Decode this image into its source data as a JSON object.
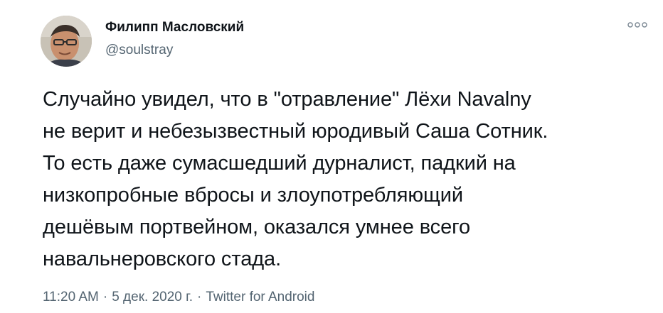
{
  "author": {
    "display_name": "Филипп Масловский",
    "handle": "@soulstray"
  },
  "icons": {
    "more": "more-options-icon",
    "avatar": "user-avatar"
  },
  "tweet": {
    "text": "Случайно увидел, что в \"отравление\" Лёхи Navalny\nне верит и небезызвестный юродивый Саша Сотник.\nТо есть даже сумасшедший дурналист, падкий на\nнизкопробные вбросы и злоупотребляющий\nдешёвым портвейном, оказался умнее всего\nнавальнеровского стада.",
    "time": "11:20 AM",
    "date": "5 дек. 2020 г.",
    "source": "Twitter for Android",
    "separator": "·"
  },
  "colors": {
    "text": "#0f1419",
    "secondary": "#536471",
    "background": "#ffffff"
  }
}
